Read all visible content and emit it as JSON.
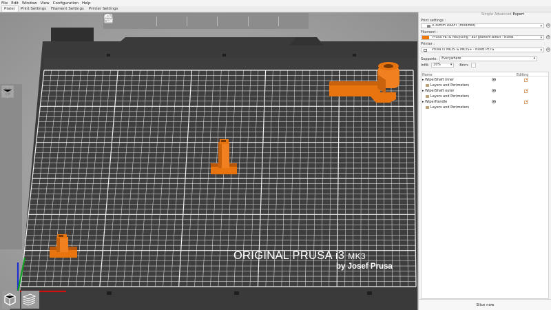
{
  "menu": [
    "File",
    "Edit",
    "Window",
    "View",
    "Configuration",
    "Help"
  ],
  "tabs": [
    {
      "label": "Plater",
      "active": true
    },
    {
      "label": "Print Settings",
      "active": false
    },
    {
      "label": "Filament Settings",
      "active": false
    },
    {
      "label": "Printer Settings",
      "active": false
    }
  ],
  "toolbar_icons": [
    "add-icon",
    "delete-icon",
    "delete-all-icon",
    "arrange-icon",
    "copy-icon",
    "paste-icon",
    "add-instance-icon",
    "remove-instance-icon",
    "split-objects-icon",
    "split-parts-icon",
    "search-icon",
    "layers-editing-icon",
    "undo-icon",
    "redo-icon"
  ],
  "left_tool_icons": [
    "move-icon",
    "scale-icon",
    "rotate-icon",
    "place-on-face-icon",
    "cut-icon",
    "supports-icon",
    "seam-icon"
  ],
  "bed": {
    "brand_line1": "ORIGINAL PRUSA i3",
    "brand_suffix": "MK3",
    "brand_line2": "by Josef Prusa"
  },
  "sidebar": {
    "modes": [
      "Simple",
      "Advanced",
      "Expert"
    ],
    "active_mode": "Expert",
    "print_settings_label": "Print settings :",
    "print_settings_value": "0.30mm DRAFT (modified)",
    "filament_label": "Filament :",
    "filament_value": "Prusa PETG Recycling - auf glattem Blech - NUeB",
    "filament_color": "#f07800",
    "printer_label": "Printer :",
    "printer_value": "Prusa i3 MK3S & MK3S+ - NUeB PETG",
    "supports_label": "Supports:",
    "supports_value": "Everywhere",
    "infill_label": "Infill:",
    "infill_value": "20%",
    "brim_label": "Brim:",
    "objects_header_name": "Name",
    "objects_header_editing": "Editing",
    "objects": [
      {
        "name": "WiperShaft inner",
        "sub": "Layers and Perimeters"
      },
      {
        "name": "WiperShaft outer",
        "sub": "Layers and Perimeters"
      },
      {
        "name": "WiperHandle",
        "sub": "Layers and Perimeters"
      }
    ],
    "slice_button": "Slice now"
  },
  "colors": {
    "part": "#e8740f",
    "part_shadow": "#b8560a",
    "bed": "#3a3a3a",
    "grid": "#d8d8d8"
  }
}
